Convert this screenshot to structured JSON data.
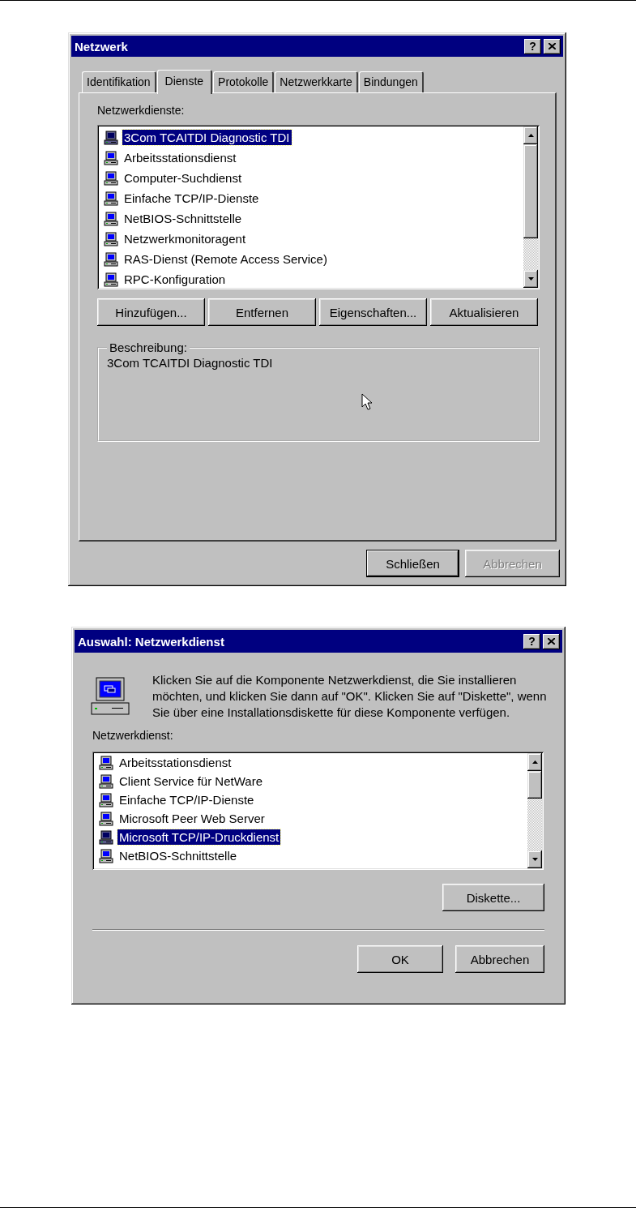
{
  "dialogs": [
    {
      "kind": "properties",
      "title": "Netzwerk",
      "help_button": "?",
      "tabs": [
        {
          "label": "Identifikation",
          "selected": false
        },
        {
          "label": "Dienste",
          "selected": true
        },
        {
          "label": "Protokolle",
          "selected": false
        },
        {
          "label": "Netzwerkkarte",
          "selected": false
        },
        {
          "label": "Bindungen",
          "selected": false
        }
      ],
      "list_label": "Netzwerkdienste:",
      "items": [
        {
          "label": "3Com TCAITDI Diagnostic TDI",
          "selected": true
        },
        {
          "label": "Arbeitsstationsdienst",
          "selected": false
        },
        {
          "label": "Computer-Suchdienst",
          "selected": false
        },
        {
          "label": "Einfache TCP/IP-Dienste",
          "selected": false
        },
        {
          "label": "NetBIOS-Schnittstelle",
          "selected": false
        },
        {
          "label": "Netzwerkmonitoragent",
          "selected": false
        },
        {
          "label": "RAS-Dienst (Remote Access Service)",
          "selected": false
        },
        {
          "label": "RPC-Konfiguration",
          "selected": false
        }
      ],
      "action_buttons": [
        "Hinzufügen...",
        "Entfernen",
        "Eigenschaften...",
        "Aktualisieren"
      ],
      "description": {
        "label": "Beschreibung:",
        "text": "3Com TCAITDI Diagnostic TDI"
      },
      "footer_buttons": [
        {
          "label": "Schließen",
          "disabled": false,
          "default": true
        },
        {
          "label": "Abbrechen",
          "disabled": true,
          "default": false
        }
      ]
    },
    {
      "kind": "select",
      "title": "Auswahl: Netzwerkdienst",
      "help_button": "?",
      "intro": "Klicken Sie auf die Komponente Netzwerkdienst, die Sie installieren möchten, und klicken Sie dann auf \"OK\".  Klicken Sie auf \"Diskette\", wenn Sie über eine Installationsdiskette für diese Komponente verfügen.",
      "list_label": "Netzwerkdienst:",
      "items": [
        {
          "label": "Arbeitsstationsdienst",
          "selected": false
        },
        {
          "label": "Client Service für NetWare",
          "selected": false
        },
        {
          "label": "Einfache TCP/IP-Dienste",
          "selected": false
        },
        {
          "label": "Microsoft Peer Web Server",
          "selected": false
        },
        {
          "label": "Microsoft TCP/IP-Druckdienst",
          "selected": true
        },
        {
          "label": "NetBIOS-Schnittstelle",
          "selected": false
        }
      ],
      "disk_button": "Diskette...",
      "footer_buttons": [
        {
          "label": "OK",
          "disabled": false,
          "default": false
        },
        {
          "label": "Abbrechen",
          "disabled": false,
          "default": false
        }
      ]
    }
  ]
}
